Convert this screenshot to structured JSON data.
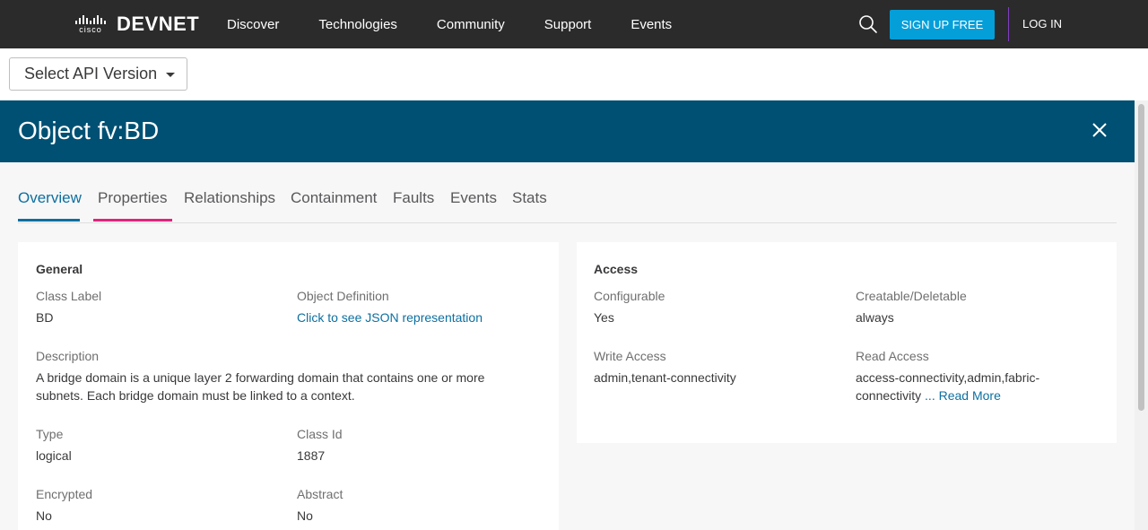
{
  "nav": {
    "logo_brand": "cisco",
    "logo_product": "DEVNET",
    "links": [
      "Discover",
      "Technologies",
      "Community",
      "Support",
      "Events"
    ],
    "signup_label": "SIGN UP FREE",
    "login_label": "LOG IN"
  },
  "version_select": {
    "label": "Select API Version"
  },
  "object": {
    "title": "Object fv:BD",
    "tabs": [
      "Overview",
      "Properties",
      "Relationships",
      "Containment",
      "Faults",
      "Events",
      "Stats"
    ],
    "active_tab": "Overview",
    "hovered_tab": "Properties"
  },
  "general": {
    "title": "General",
    "class_label": {
      "label": "Class Label",
      "value": "BD"
    },
    "object_definition": {
      "label": "Object Definition",
      "value": "Click to see JSON representation"
    },
    "description": {
      "label": "Description",
      "value": "A bridge domain is a unique layer 2 forwarding domain that contains one or more subnets. Each bridge domain must be linked to a context."
    },
    "type": {
      "label": "Type",
      "value": "logical"
    },
    "class_id": {
      "label": "Class Id",
      "value": "1887"
    },
    "encrypted": {
      "label": "Encrypted",
      "value": "No"
    },
    "abstract": {
      "label": "Abstract",
      "value": "No"
    }
  },
  "access": {
    "title": "Access",
    "configurable": {
      "label": "Configurable",
      "value": "Yes"
    },
    "creatable_deletable": {
      "label": "Creatable/Deletable",
      "value": "always"
    },
    "write_access": {
      "label": "Write Access",
      "value": "admin,tenant-connectivity"
    },
    "read_access": {
      "label": "Read Access",
      "value_line1": "access-connectivity,admin,fabric-",
      "value_line2": "connectivity",
      "read_more": "... Read More"
    }
  },
  "colors": {
    "nav_bg": "#2b2b2b",
    "header_bg": "#005073",
    "accent": "#049fd9",
    "tab_active": "#0d6fa0",
    "tab_hover_underline": "#e2237d"
  }
}
